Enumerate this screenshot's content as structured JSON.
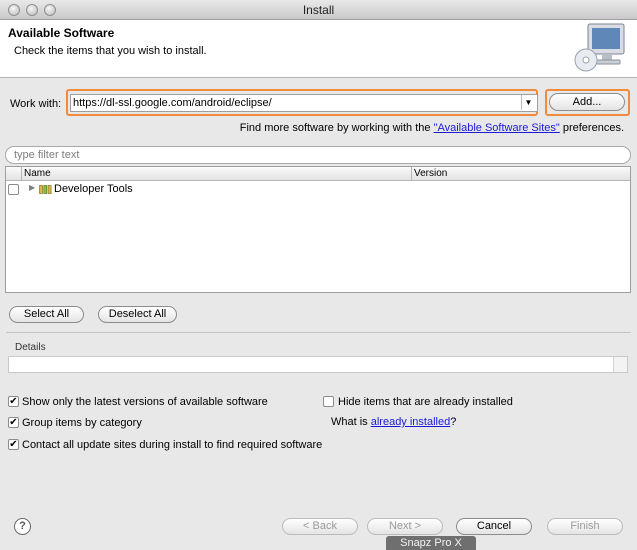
{
  "window": {
    "title": "Install"
  },
  "header": {
    "title": "Available Software",
    "subtitle": "Check the items that you wish to install.",
    "icon": "monitor-cd-icon"
  },
  "work_with": {
    "label": "Work with:",
    "value": "https://dl-ssl.google.com/android/eclipse/",
    "add_label": "Add..."
  },
  "find_more": {
    "prefix": "Find more software by working with the ",
    "link": "\"Available Software Sites\"",
    "suffix": " preferences."
  },
  "filter": {
    "placeholder": "type filter text"
  },
  "table": {
    "columns": [
      "Name",
      "Version"
    ],
    "rows": [
      {
        "name": "Developer Tools",
        "version": "",
        "checked": false,
        "icon": "package-group-icon"
      }
    ]
  },
  "selection": {
    "select_all": "Select All",
    "deselect_all": "Deselect All"
  },
  "details": {
    "label": "Details"
  },
  "options": {
    "latest": {
      "label": "Show only the latest versions of available software",
      "checked": true
    },
    "group": {
      "label": "Group items by category",
      "checked": true
    },
    "contact": {
      "label": "Contact all update sites during install to find required software",
      "checked": true
    },
    "hide": {
      "label": "Hide items that are already installed",
      "checked": false
    },
    "what_is_prefix": "What is ",
    "what_is_link": "already installed",
    "what_is_suffix": "?"
  },
  "footer": {
    "back": "< Back",
    "next": "Next >",
    "cancel": "Cancel",
    "finish": "Finish"
  },
  "watermark": "Snapz Pro X",
  "colors": {
    "highlight": "#f08a3c",
    "link": "#1b1bd6"
  }
}
